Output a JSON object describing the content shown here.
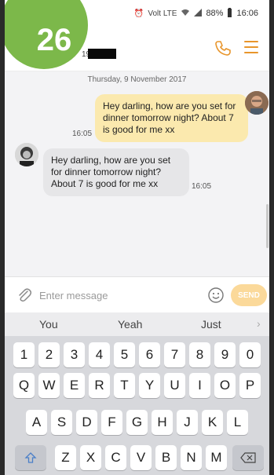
{
  "badge": {
    "number": "26"
  },
  "status_bar": {
    "network": "Volt LTE",
    "battery": "88%",
    "time": "16:06"
  },
  "header": {
    "contact_partial": "19"
  },
  "conversation": {
    "date": "Thursday, 9 November 2017",
    "messages": [
      {
        "direction": "sent",
        "text": "Hey darling, how are you set for dinner tomorrow night? About 7 is good for me xx",
        "time": "16:05"
      },
      {
        "direction": "received",
        "text": "Hey darling, how are you set for dinner tomorrow night? About 7 is good for me xx",
        "time": "16:05"
      }
    ]
  },
  "input": {
    "placeholder": "Enter message",
    "send_label": "SEND"
  },
  "suggestions": [
    "You",
    "Yeah",
    "Just"
  ],
  "keyboard": {
    "row_numbers": [
      "1",
      "2",
      "3",
      "4",
      "5",
      "6",
      "7",
      "8",
      "9",
      "0"
    ],
    "row_top": [
      "Q",
      "W",
      "E",
      "R",
      "T",
      "Y",
      "U",
      "I",
      "O",
      "P"
    ],
    "row_middle": [
      "A",
      "S",
      "D",
      "F",
      "G",
      "H",
      "J",
      "K",
      "L"
    ],
    "row_bottom": [
      "Z",
      "X",
      "C",
      "V",
      "B",
      "N",
      "M"
    ]
  },
  "colors": {
    "accent": "#e8952b",
    "sent_bubble": "#fbe9ae",
    "received_bubble": "#e6e6e8",
    "badge": "#7cb84a",
    "send_button": "#fbd99a"
  }
}
